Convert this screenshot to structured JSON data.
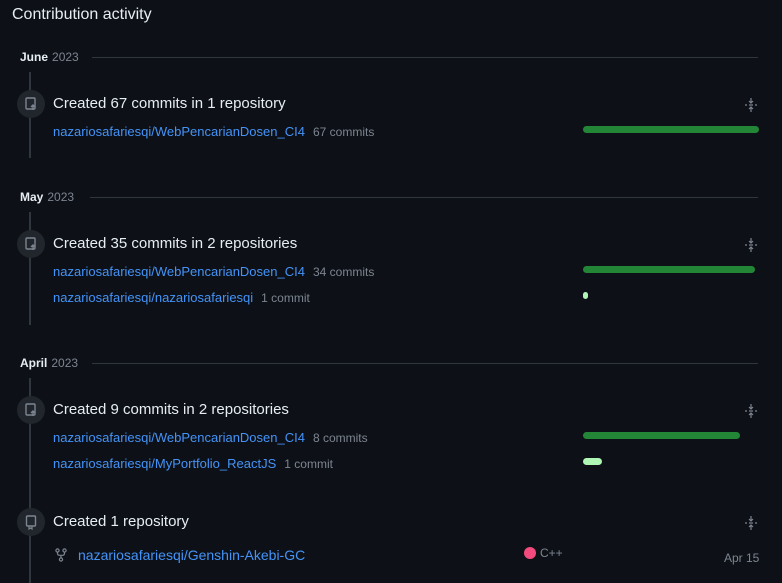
{
  "title": "Contribution activity",
  "months": [
    {
      "month": "June",
      "year": "2023"
    },
    {
      "month": "May",
      "year": "2023"
    },
    {
      "month": "April",
      "year": "2023"
    }
  ],
  "events": [
    {
      "title": "Created 67 commits in 1 repository",
      "repos": [
        {
          "name": "nazariosafariesqi/WebPencarianDosen_CI4",
          "count": "67 commits",
          "fraction": 1.0
        }
      ]
    },
    {
      "title": "Created 35 commits in 2 repositories",
      "repos": [
        {
          "name": "nazariosafariesqi/WebPencarianDosen_CI4",
          "count": "34 commits",
          "fraction": 0.98
        },
        {
          "name": "nazariosafariesqi/nazariosafariesqi",
          "count": "1 commit",
          "fraction": 0.03
        }
      ]
    },
    {
      "title": "Created 9 commits in 2 repositories",
      "repos": [
        {
          "name": "nazariosafariesqi/WebPencarianDosen_CI4",
          "count": "8 commits",
          "fraction": 0.89
        },
        {
          "name": "nazariosafariesqi/MyPortfolio_ReactJS",
          "count": "1 commit",
          "fraction": 0.11
        }
      ]
    },
    {
      "title": "Created 1 repository",
      "repo": {
        "name": "nazariosafariesqi/Genshin-Akebi-GC",
        "language": "C++",
        "language_color": "#f34b7d",
        "date": "Apr 15"
      }
    }
  ],
  "colors": {
    "bar_primary": "#238636",
    "bar_secondary": "#aff5b4",
    "link": "#4493f8"
  },
  "icons": {
    "commit_event": "repo-push-icon",
    "repo_event": "repo-icon",
    "fold": "fold-icon",
    "fork": "repo-forked-icon"
  }
}
